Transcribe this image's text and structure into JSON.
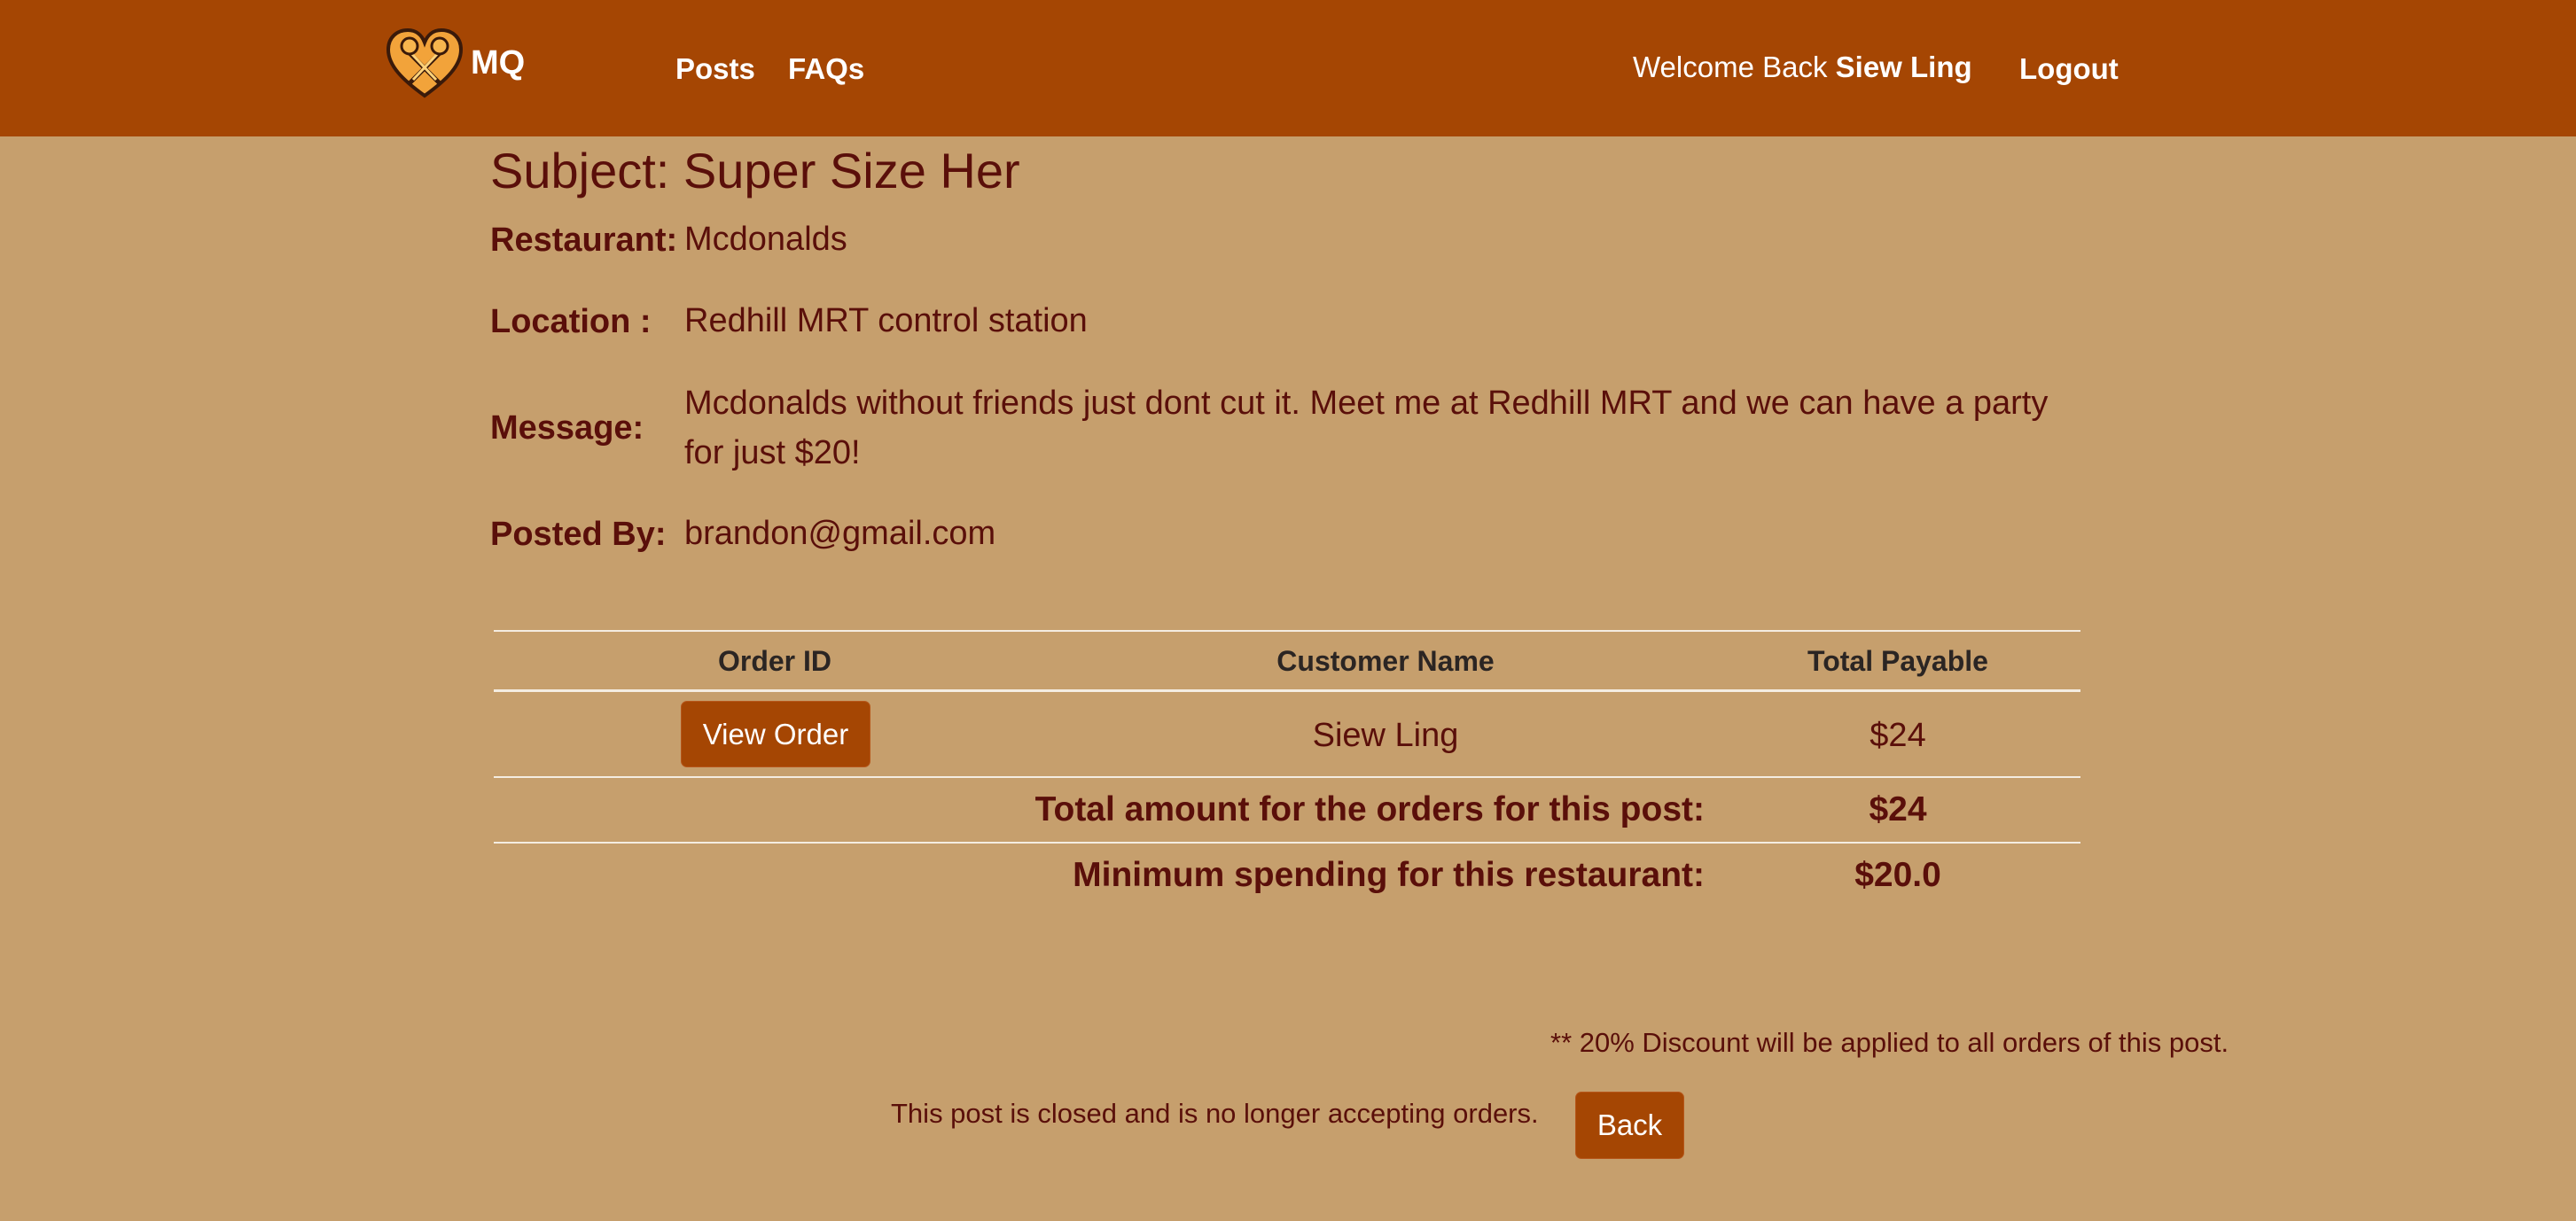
{
  "nav": {
    "brand": "MQ",
    "links": [
      "Posts",
      "FAQs"
    ],
    "welcome_prefix": "Welcome Back",
    "user_name": "Siew Ling",
    "logout": "Logout"
  },
  "post": {
    "subject": "Subject: Super Size Her",
    "fields": [
      {
        "label": "Restaurant:",
        "value": "Mcdonalds"
      },
      {
        "label": "Location :",
        "value": "Redhill MRT control station"
      },
      {
        "label": "Message:",
        "value_lines": [
          "Mcdonalds without friends just dont cut it. Meet me at Redhill MRT and we can have a party",
          "for just $20!"
        ]
      },
      {
        "label": "Posted By:",
        "value": "brandon@gmail.com"
      }
    ]
  },
  "orders": {
    "headers": [
      "Order ID",
      "Customer Name",
      "Total Payable"
    ],
    "rows": [
      {
        "action": "View Order",
        "customer": "Siew Ling",
        "total": "$24"
      }
    ],
    "summary": [
      {
        "label": "Total amount for the orders for this post:",
        "value": "$24"
      },
      {
        "label": "Minimum spending for this restaurant:",
        "value": "$20.0"
      }
    ]
  },
  "footer": {
    "discount_note": "** 20% Discount will be applied to all orders of this post.",
    "closed_note": "This post is closed and is no longer accepting orders.",
    "back": "Back"
  },
  "colors": {
    "navbar": "#a54603",
    "background": "#c69f6d",
    "text": "#5a0f0a",
    "button": "#a54603"
  },
  "icons": {
    "logo": "pretzel-heart-icon"
  }
}
